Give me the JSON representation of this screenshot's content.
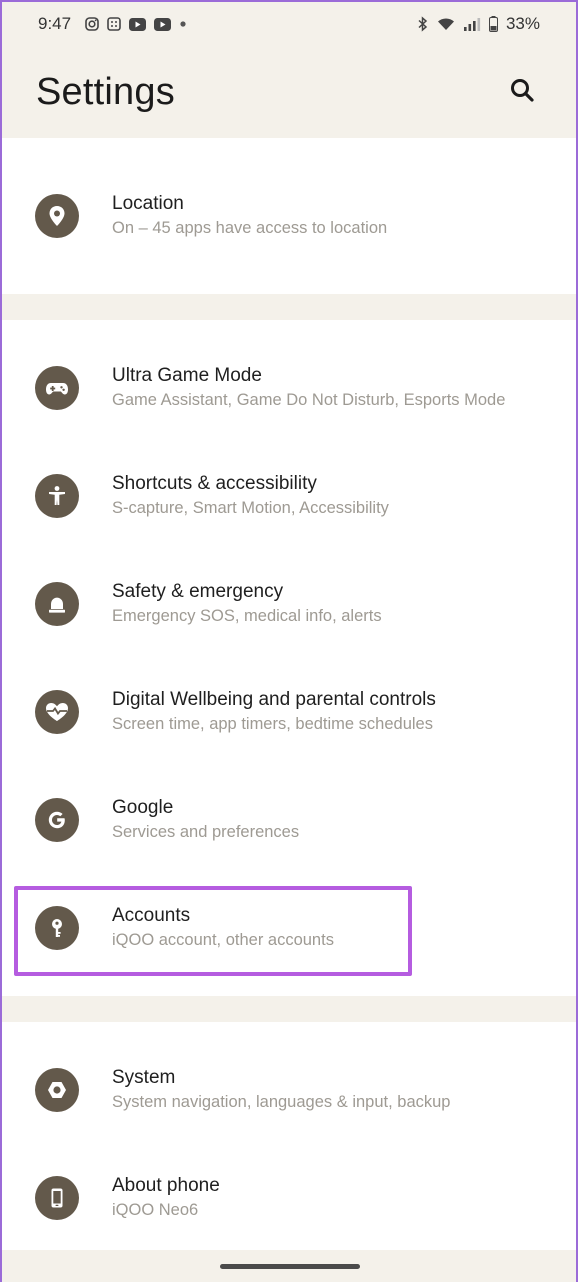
{
  "status_bar": {
    "time": "9:47",
    "left_icons": [
      "instagram-icon",
      "app-grid-icon",
      "youtube-icon",
      "youtube-icon",
      "dot-icon"
    ],
    "right_icons": [
      "bluetooth-icon",
      "wifi-icon",
      "signal-icon",
      "battery-icon"
    ],
    "battery": "33%"
  },
  "header": {
    "title": "Settings",
    "search_icon": "search-icon"
  },
  "groups": [
    {
      "items": [
        {
          "id": "location",
          "icon": "location-pin-icon",
          "title": "Location",
          "subtitle": "On – 45 apps have access to location"
        }
      ]
    },
    {
      "items": [
        {
          "id": "ultra-game-mode",
          "icon": "gamepad-icon",
          "title": "Ultra Game Mode",
          "subtitle": "Game Assistant, Game Do Not Disturb, Esports Mode"
        },
        {
          "id": "shortcuts-accessibility",
          "icon": "accessibility-icon",
          "title": "Shortcuts & accessibility",
          "subtitle": "S-capture, Smart Motion, Accessibility"
        },
        {
          "id": "safety-emergency",
          "icon": "emergency-light-icon",
          "title": "Safety & emergency",
          "subtitle": "Emergency SOS, medical info, alerts"
        },
        {
          "id": "digital-wellbeing",
          "icon": "heart-icon",
          "title": "Digital Wellbeing and parental controls",
          "subtitle": "Screen time, app timers, bedtime schedules"
        },
        {
          "id": "google",
          "icon": "google-icon",
          "title": "Google",
          "subtitle": "Services and preferences"
        },
        {
          "id": "accounts",
          "icon": "key-icon",
          "title": "Accounts",
          "subtitle": "iQOO account, other accounts"
        }
      ]
    },
    {
      "items": [
        {
          "id": "system",
          "icon": "hexagon-gear-icon",
          "title": "System",
          "subtitle": "System navigation, languages & input, backup"
        },
        {
          "id": "about-phone",
          "icon": "phone-icon",
          "title": "About phone",
          "subtitle": "iQOO Neo6"
        }
      ]
    }
  ],
  "colors": {
    "background": "#f4f1ea",
    "icon_circle": "#63594b",
    "highlight": "#b55ce0"
  }
}
